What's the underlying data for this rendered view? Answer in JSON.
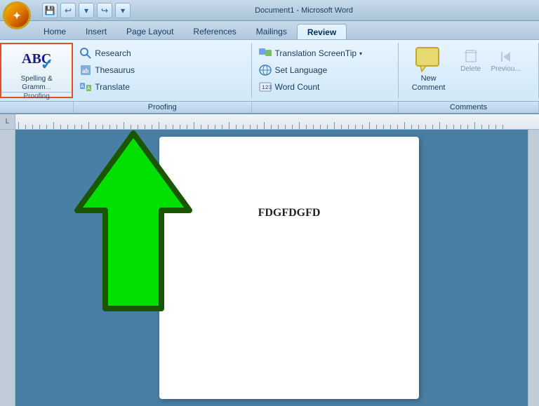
{
  "titlebar": {
    "title": "Document1 - Microsoft Word"
  },
  "ribbon": {
    "tabs": [
      {
        "label": "Home",
        "active": false
      },
      {
        "label": "Insert",
        "active": false
      },
      {
        "label": "Page Layout",
        "active": false
      },
      {
        "label": "References",
        "active": false
      },
      {
        "label": "Mailings",
        "active": false
      },
      {
        "label": "Review",
        "active": true
      }
    ],
    "groups": {
      "spelling": {
        "label": "Spelling &\nGrammar",
        "section": "Proofing"
      },
      "proofing": {
        "research": "Research",
        "thesaurus": "Thesaurus",
        "translate": "Translate"
      },
      "translation": {
        "screentip": "Translation ScreenTip",
        "language": "Set Language",
        "wordcount": "Word Count"
      },
      "comments": {
        "new": "New\nComment",
        "delete": "Delete",
        "previous": "Previou...",
        "section": "Comments"
      }
    }
  },
  "document": {
    "content": "FDGFDGFD"
  },
  "sections": {
    "proofing": "Proofing",
    "comments": "Comments"
  },
  "cursor": {
    "visible": true
  }
}
